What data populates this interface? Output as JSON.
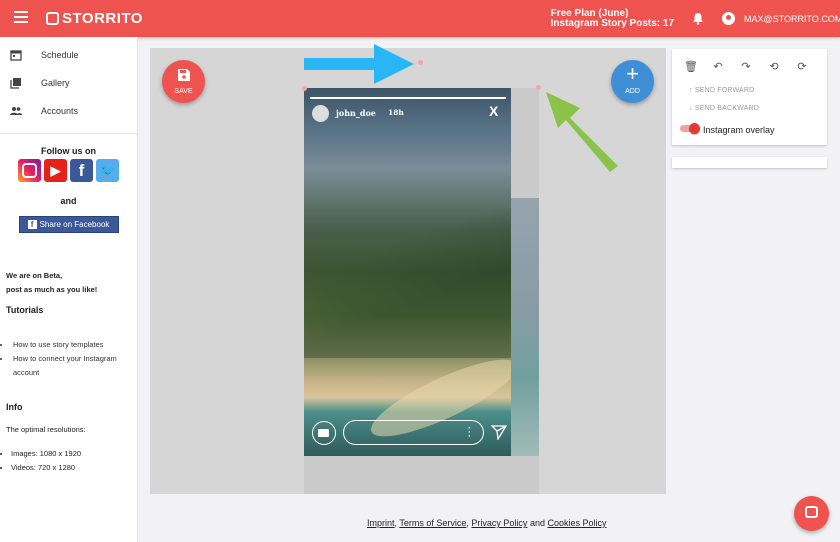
{
  "header": {
    "brand": "STORRITO",
    "plan_line1": "Free Plan (June)",
    "plan_line2": "Instagram Story Posts: 17",
    "email": "MAX@STORRITO.COM",
    "accent_color": "#ef5350"
  },
  "sidebar": {
    "items": [
      {
        "label": "Schedule",
        "icon": "calendar-icon"
      },
      {
        "label": "Gallery",
        "icon": "gallery-icon"
      },
      {
        "label": "Accounts",
        "icon": "people-icon"
      }
    ],
    "follow_title": "Follow us on",
    "and_text": "and",
    "share_label": "Share on Facebook",
    "beta_line1": "We are on Beta,",
    "beta_line2": "post as much as you like!",
    "tutorials_title": "Tutorials",
    "tutorials": [
      "How to use story templates",
      "How to connect your Instagram account"
    ],
    "info_title": "Info",
    "info_text": "The optimal resolutions:",
    "resolutions": [
      "Images: 1080 x 1920",
      "Videos: 720 x 1280"
    ]
  },
  "editor": {
    "save_label": "SAVE",
    "add_label": "ADD",
    "story": {
      "username": "john_doe",
      "time": "18h",
      "close": "X"
    }
  },
  "panel": {
    "send_forward": "SEND FORWARD",
    "send_backward": "SEND BACKWARD",
    "overlay_label": "Instagram overlay",
    "overlay_on": true
  },
  "footer": {
    "imprint": "Imprint",
    "terms": "Terms of Service",
    "privacy": "Privacy Policy",
    "and": "and",
    "cookies": "Cookies Policy"
  }
}
